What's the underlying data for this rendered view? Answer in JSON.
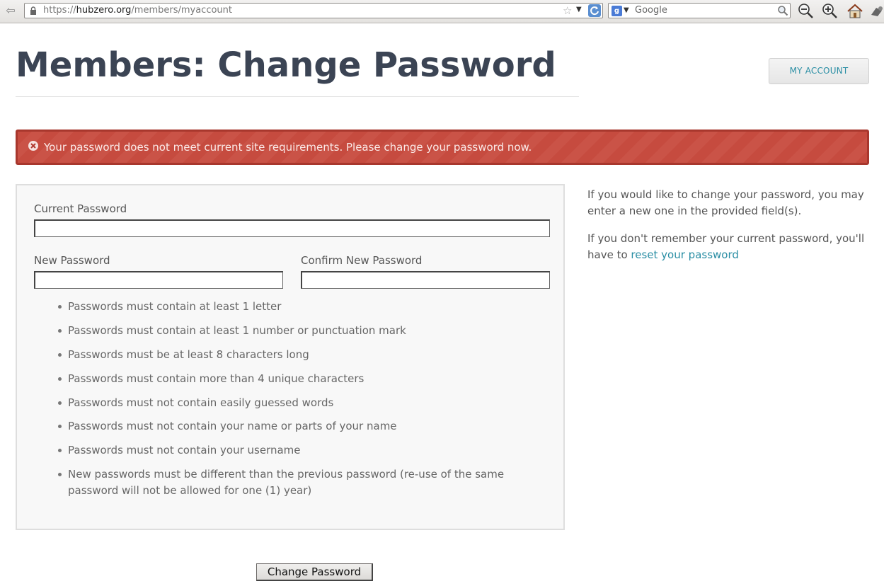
{
  "browser": {
    "url_prefix": "https://",
    "url_host": "hubzero.org",
    "url_path": "/members/myaccount",
    "search_placeholder": "Google"
  },
  "header": {
    "title": "Members: Change Password",
    "my_account_label": "My Account"
  },
  "alert": {
    "message": "Your password does not meet current site requirements. Please change your password now."
  },
  "form": {
    "current_password_label": "Current Password",
    "new_password_label": "New Password",
    "confirm_password_label": "Confirm New Password",
    "current_password_value": "",
    "new_password_value": "",
    "confirm_password_value": "",
    "rules": [
      "Passwords must contain at least 1 letter",
      "Passwords must contain at least 1 number or punctuation mark",
      "Passwords must be at least 8 characters long",
      "Passwords must contain more than 4 unique characters",
      "Passwords must not contain easily guessed words",
      "Passwords must not contain your name or parts of your name",
      "Passwords must not contain your username",
      "New passwords must be different than the previous password (re-use of the same password will not be allowed for one (1) year)"
    ],
    "submit_label": "Change Password"
  },
  "sidebar": {
    "info_text": "If you would like to change your password, you may enter a new one in the provided field(s).",
    "reset_prefix": "If you don't remember your current password, you'll have to",
    "reset_link": "reset your password"
  },
  "colors": {
    "alert_bg": "#c64b3f",
    "link": "#2a8ea4",
    "title": "#3b4454"
  }
}
